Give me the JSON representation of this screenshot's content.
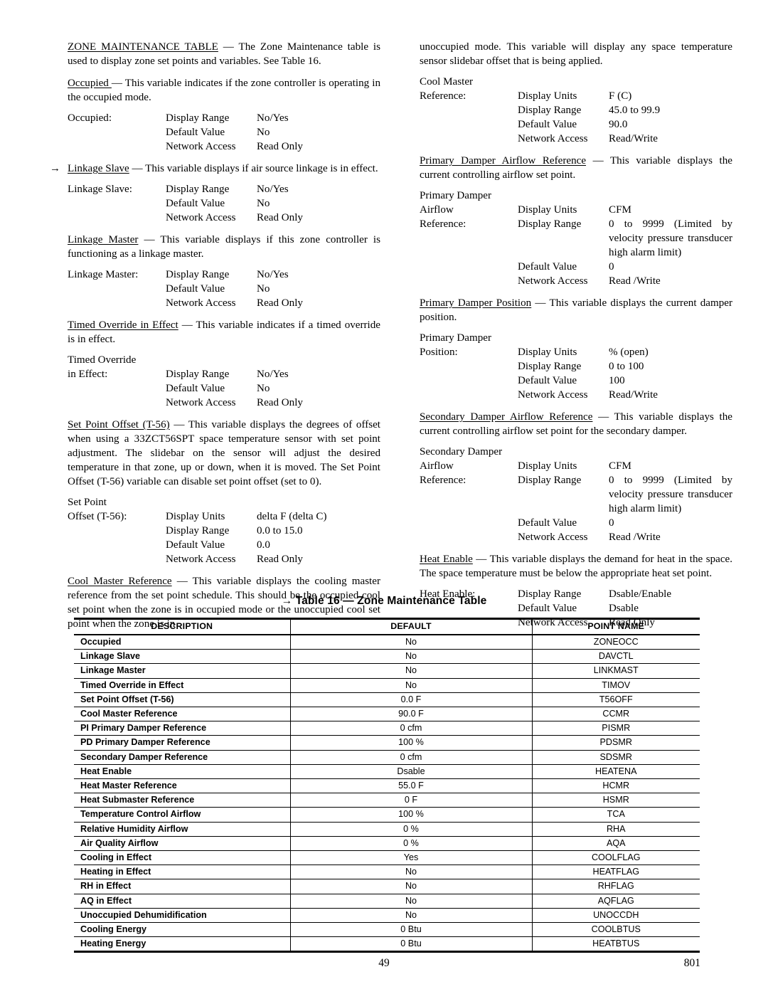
{
  "left_column": {
    "intro": {
      "term": "ZONE MAINTENANCE TABLE",
      "body": " — The Zone Maintenance table is used to display zone set points and variables. See Table 16."
    },
    "sections": [
      {
        "arrow": "",
        "term": "Occupied ",
        "body": "— This variable indicates if the zone controller is operating in the occupied mode.",
        "block_label": "Occupied:",
        "block_label_line2": "",
        "rows": [
          {
            "field": "Display Range",
            "value": "No/Yes"
          },
          {
            "field": "Default Value",
            "value": "No"
          },
          {
            "field": "Network Access",
            "value": "Read Only"
          }
        ]
      },
      {
        "arrow": "→",
        "term": "Linkage Slave",
        "body": " — This variable displays if air source linkage is in effect.",
        "block_label": "Linkage Slave:",
        "block_label_line2": "",
        "rows": [
          {
            "field": "Display Range",
            "value": "No/Yes"
          },
          {
            "field": "Default Value",
            "value": "No"
          },
          {
            "field": "Network Access",
            "value": "Read Only"
          }
        ]
      },
      {
        "arrow": "",
        "term": "Linkage Master",
        "body": " — This variable displays if this zone controller is functioning as a linkage master.",
        "block_label": "Linkage Master:",
        "block_label_line2": "",
        "rows": [
          {
            "field": "Display Range",
            "value": "No/Yes"
          },
          {
            "field": "Default Value",
            "value": "No"
          },
          {
            "field": "Network Access",
            "value": "Read Only"
          }
        ]
      },
      {
        "arrow": "",
        "term": "Timed Override in Effect",
        "body": " — This variable indicates if a timed override is in effect.",
        "block_label": "Timed Override",
        "block_label_line2": "in Effect:",
        "rows": [
          {
            "field": "Display Range",
            "value": "No/Yes"
          },
          {
            "field": "Default Value",
            "value": "No"
          },
          {
            "field": "Network Access",
            "value": "Read Only"
          }
        ]
      },
      {
        "arrow": "",
        "term": "Set Point Offset (T-56)",
        "body": " — This variable displays the degrees of offset when using a 33ZCT56SPT space temperature sensor with set point adjustment. The slidebar on the sensor will adjust the desired temperature in that zone, up or down, when it is moved. The Set Point Offset (T-56) variable can disable set point offset (set to 0).",
        "block_label": "Set Point",
        "block_label_line2": "Offset (T-56):",
        "rows": [
          {
            "field": "Display Units",
            "value": "delta F (delta C)"
          },
          {
            "field": "Display Range",
            "value": "0.0 to 15.0"
          },
          {
            "field": "Default Value",
            "value": "0.0"
          },
          {
            "field": "Network Access",
            "value": "Read Only"
          }
        ]
      },
      {
        "arrow": "",
        "term": "Cool Master Reference",
        "body": " — This variable displays the cooling master reference from the set point schedule. This should be the occupied cool set point when the zone is in occupied mode or the unoccupied cool set point when the zone is in",
        "block_label": "",
        "block_label_line2": "",
        "rows": []
      }
    ]
  },
  "right_column": {
    "continuation": "unoccupied mode. This variable will display any space temperature sensor slidebar offset that is being applied.",
    "sections": [
      {
        "term": "",
        "body": "",
        "block_label": "Cool Master",
        "block_label_line2": "Reference:",
        "rows": [
          {
            "field": "Display Units",
            "value": "F (C)"
          },
          {
            "field": "Display Range",
            "value": "45.0 to 99.9"
          },
          {
            "field": "Default Value",
            "value": "90.0"
          },
          {
            "field": "Network Access",
            "value": "Read/Write"
          }
        ]
      },
      {
        "term": "Primary Damper Airflow Reference",
        "body": " — This variable displays the current controlling airflow set point.",
        "block_label": "Primary Damper",
        "block_label_line2": "Airflow",
        "block_label_line3": "Reference:",
        "rows": [
          {
            "field": "Display Units",
            "value": "CFM"
          },
          {
            "field": "Display Range",
            "value": "0 to 9999 (Limited by velocity pressure transducer high alarm limit)"
          },
          {
            "field": "Default Value",
            "value": "0"
          },
          {
            "field": "Network Access",
            "value": "Read /Write"
          }
        ]
      },
      {
        "term": "Primary Damper Position",
        "body": " — This variable displays the current damper position.",
        "block_label": "Primary Damper",
        "block_label_line2": "Position:",
        "rows": [
          {
            "field": "Display Units",
            "value": "% (open)"
          },
          {
            "field": "Display Range",
            "value": "0 to 100"
          },
          {
            "field": "Default Value",
            "value": "100"
          },
          {
            "field": "Network Access",
            "value": "Read/Write"
          }
        ]
      },
      {
        "term": "Secondary Damper Airflow Reference",
        "body": " — This variable displays the current controlling airflow set point for the secondary damper.",
        "block_label": "Secondary Damper",
        "block_label_line2": "Airflow",
        "block_label_line3": "Reference:",
        "rows": [
          {
            "field": "Display Units",
            "value": "CFM"
          },
          {
            "field": "Display Range",
            "value": "0 to 9999 (Limited by velocity pressure transducer high alarm limit)"
          },
          {
            "field": "Default Value",
            "value": "0"
          },
          {
            "field": "Network Access",
            "value": "Read /Write"
          }
        ]
      },
      {
        "term": "Heat Enable",
        "body": " — This variable displays the demand for heat in the space. The space temperature must be below the appropriate heat set point.",
        "block_label": "Heat Enable:",
        "block_label_line2": "",
        "rows": [
          {
            "field": "Display Range",
            "value": "Dsable/Enable"
          },
          {
            "field": "Default Value",
            "value": "Dsable"
          },
          {
            "field": "Network Access",
            "value": "Read Only"
          }
        ]
      }
    ]
  },
  "table": {
    "arrow": "→",
    "title": "Table 16 — Zone Maintenance Table",
    "headers": [
      "DESCRIPTION",
      "DEFAULT",
      "POINT NAME"
    ],
    "rows": [
      [
        "Occupied",
        "No",
        "ZONEOCC"
      ],
      [
        "Linkage Slave",
        "No",
        "DAVCTL"
      ],
      [
        "Linkage Master",
        "No",
        "LINKMAST"
      ],
      [
        "Timed Override in Effect",
        "No",
        "TIMOV"
      ],
      [
        "Set Point Offset (T-56)",
        "0.0 F",
        "T56OFF"
      ],
      [
        "Cool Master Reference",
        "90.0 F",
        "CCMR"
      ],
      [
        "PI Primary Damper Reference",
        "0 cfm",
        "PISMR"
      ],
      [
        "PD Primary Damper Reference",
        "100 %",
        "PDSMR"
      ],
      [
        "Secondary Damper Reference",
        "0 cfm",
        "SDSMR"
      ],
      [
        "Heat Enable",
        "Dsable",
        "HEATENA"
      ],
      [
        "Heat Master Reference",
        "55.0 F",
        "HCMR"
      ],
      [
        "Heat Submaster Reference",
        "0 F",
        "HSMR"
      ],
      [
        "Temperature Control Airflow",
        "100 %",
        "TCA"
      ],
      [
        "Relative Humidity Airflow",
        "0 %",
        "RHA"
      ],
      [
        "Air Quality Airflow",
        "0 %",
        "AQA"
      ],
      [
        "Cooling in Effect",
        "Yes",
        "COOLFLAG"
      ],
      [
        "Heating in Effect",
        "No",
        "HEATFLAG"
      ],
      [
        "RH in Effect",
        "No",
        "RHFLAG"
      ],
      [
        "AQ in Effect",
        "No",
        "AQFLAG"
      ],
      [
        "Unoccupied Dehumidification",
        "No",
        "UNOCCDH"
      ],
      [
        "Cooling Energy",
        "0 Btu",
        "COOLBTUS"
      ],
      [
        "Heating Energy",
        "0 Btu",
        "HEATBTUS"
      ]
    ]
  },
  "footer": {
    "page_number": "49",
    "doc_number": "801"
  }
}
